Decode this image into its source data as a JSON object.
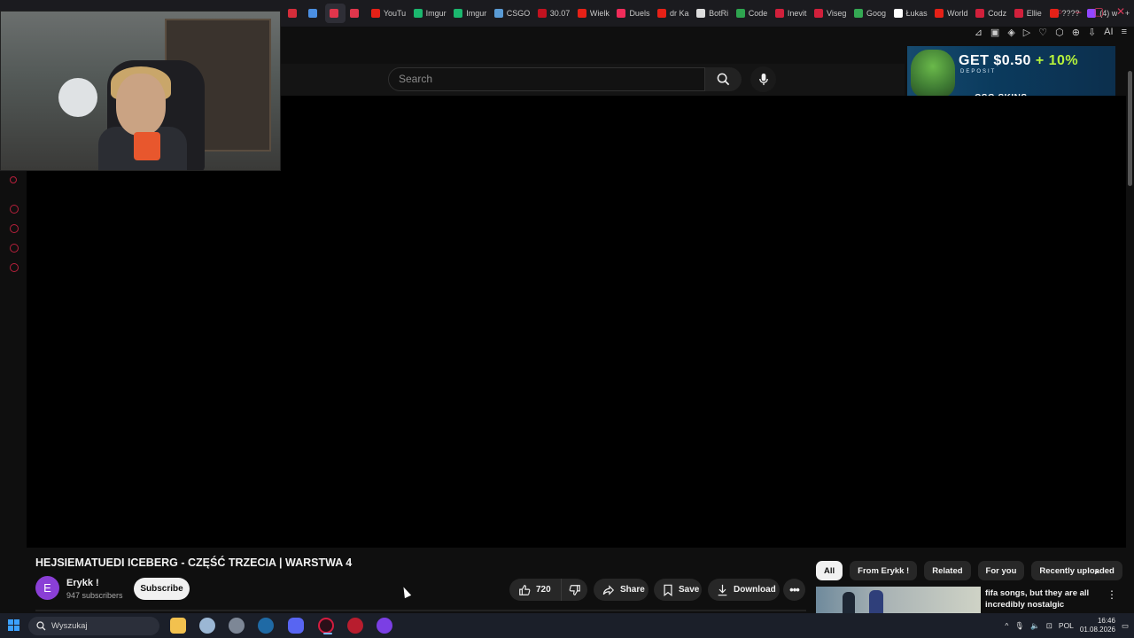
{
  "browser": {
    "tabs": [
      {
        "label": "",
        "color": "#d42d3a"
      },
      {
        "label": "",
        "color": "#4b8fe2"
      },
      {
        "label": "",
        "color": "#e1364c"
      },
      {
        "label": "",
        "color": "#e1364c"
      },
      {
        "label": "YouTu",
        "color": "#e62117"
      },
      {
        "label": "Imgur",
        "color": "#1bb76e"
      },
      {
        "label": "Imgur",
        "color": "#1bb76e"
      },
      {
        "label": "CSGO",
        "color": "#5a9bd5"
      },
      {
        "label": "30.07",
        "color": "#c1121f"
      },
      {
        "label": "Wielk",
        "color": "#e62117"
      },
      {
        "label": "Duels",
        "color": "#f02c5a"
      },
      {
        "label": "dr Ka",
        "color": "#e62117"
      },
      {
        "label": "BotRi",
        "color": "#dddddd"
      },
      {
        "label": "Code",
        "color": "#2ea44f"
      },
      {
        "label": "Inevit",
        "color": "#d1203b"
      },
      {
        "label": "Viseg",
        "color": "#d1203b"
      },
      {
        "label": "Goog",
        "color": "#34a853"
      },
      {
        "label": "Łukas",
        "color": "#ffffff"
      },
      {
        "label": "World",
        "color": "#e62117"
      },
      {
        "label": "Codz",
        "color": "#d1203b"
      },
      {
        "label": "Ellie",
        "color": "#d1203b"
      },
      {
        "label": "????",
        "color": "#e62117"
      },
      {
        "label": "(4) w",
        "color": "#9147ff"
      }
    ],
    "new_tab_label": "+"
  },
  "search": {
    "placeholder": "Search"
  },
  "ad": {
    "headline_main": "GET $0.50",
    "headline_bonus": "+ 10%",
    "subline": "DEPOSIT",
    "brand": "CSG SKINS"
  },
  "video": {
    "title": "HEJSIEMATUEDI ICEBERG - CZĘŚĆ TRZECIA | WARSTWA 4",
    "channel": {
      "avatar_letter": "E",
      "name": "Erykk !",
      "subscribers": "947 subscribers",
      "subscribe_label": "Subscribe"
    },
    "actions": {
      "likes": "720",
      "share": "Share",
      "save": "Save",
      "download": "Download"
    }
  },
  "recommendations": {
    "chips": [
      "All",
      "From Erykk !",
      "Related",
      "For you",
      "Recently uploaded"
    ],
    "first_item_title": "fifa songs, but they are all incredibly nostalgic"
  },
  "taskbar": {
    "search_placeholder": "Wyszukaj",
    "language": "POL",
    "time": "16:46",
    "date": "01.08.2026"
  },
  "colors": {
    "accent": "#e62117",
    "background": "#0f0f0f",
    "taskbar": "#1b1f29"
  }
}
